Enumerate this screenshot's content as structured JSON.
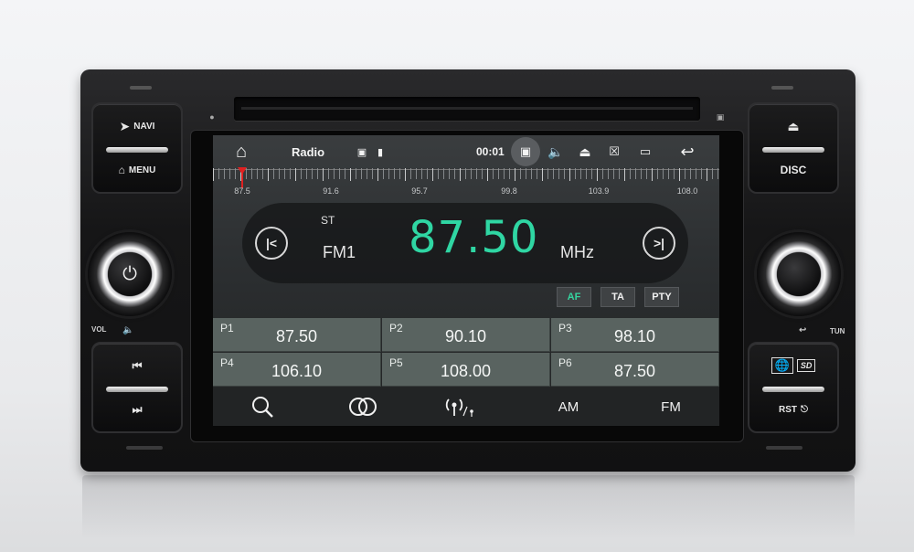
{
  "left_panel": {
    "navi_label": "NAVI",
    "menu_label": "MENU",
    "vol_label": "VOL"
  },
  "right_panel": {
    "disc_label": "DISC",
    "tun_label": "TUN",
    "rst_label": "RST"
  },
  "status_bar": {
    "title": "Radio",
    "time": "00:01"
  },
  "tuner": {
    "scale_labels": [
      "87.5",
      "91.6",
      "95.7",
      "99.8",
      "103.9",
      "108.0"
    ],
    "stereo": "ST",
    "band": "FM1",
    "frequency": "87.50",
    "unit": "MHz",
    "accent_color": "#2fd6a3"
  },
  "toggles": {
    "af": "AF",
    "ta": "TA",
    "pty": "PTY",
    "af_active": true
  },
  "presets": [
    {
      "label": "P1",
      "value": "87.50"
    },
    {
      "label": "P2",
      "value": "90.10"
    },
    {
      "label": "P3",
      "value": "98.10"
    },
    {
      "label": "P4",
      "value": "106.10"
    },
    {
      "label": "P5",
      "value": "108.00"
    },
    {
      "label": "P6",
      "value": "87.50"
    }
  ],
  "bottom_bar": {
    "am_label": "AM",
    "fm_label": "FM",
    "icons": [
      "search-icon",
      "stereo-icon",
      "rds-antenna-icon"
    ]
  }
}
